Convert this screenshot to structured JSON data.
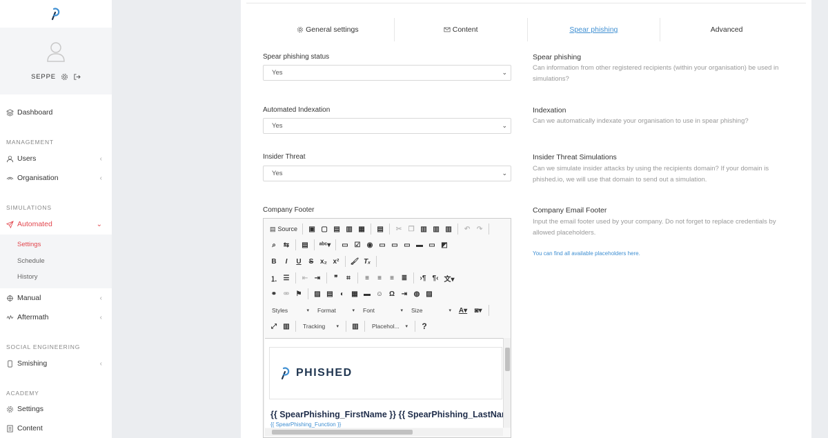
{
  "sidebar": {
    "username": "SEPPE",
    "items": {
      "dashboard": "Dashboard",
      "users": "Users",
      "organisation": "Organisation",
      "automated": "Automated",
      "settings": "Settings",
      "schedule": "Schedule",
      "history": "History",
      "manual": "Manual",
      "aftermath": "Aftermath",
      "smishing": "Smishing",
      "academy_settings": "Settings",
      "academy_content": "Content"
    },
    "sections": {
      "management": "MANAGEMENT",
      "simulations": "SIMULATIONS",
      "social_engineering": "SOCIAL ENGINEERING",
      "academy": "ACADEMY"
    },
    "accent_color": "#e2464d"
  },
  "tabs": {
    "general": "General settings",
    "content": "Content",
    "spear": "Spear phishing",
    "advanced": "Advanced"
  },
  "form": {
    "spear_status": {
      "label": "Spear phishing status",
      "value": "Yes"
    },
    "indexation": {
      "label": "Automated Indexation",
      "value": "Yes"
    },
    "insider": {
      "label": "Insider Threat",
      "value": "Yes"
    },
    "footer_label": "Company Footer"
  },
  "help": {
    "spear": {
      "title": "Spear phishing",
      "text": "Can information from other registered recipients (within your organisation) be used in simulations?"
    },
    "indexation": {
      "title": "Indexation",
      "text": "Can we automatically indexate your organisation to use in spear phishing?"
    },
    "insider": {
      "title": "Insider Threat Simulations",
      "text": "Can we simulate insider attacks by using the recipients domain? If your domain is phished.io, we will use that domain to send out a simulation."
    },
    "footer": {
      "title": "Company Email Footer",
      "text": "Input the email footer used by your company. Do not forget to replace credentials by allowed placeholders.",
      "link": "You can find all available placeholders here."
    }
  },
  "editor": {
    "source": "Source",
    "styles": "Styles",
    "format": "Format",
    "font": "Font",
    "size": "Size",
    "tracking": "Tracking",
    "placeholders": "Placehol...",
    "help": "?",
    "brand": "PHISHED",
    "name_line": "{{ SpearPhishing_FirstName }} {{ SpearPhishing_LastName }}",
    "function_line": "{{ SpearPhishing_Function }}"
  }
}
